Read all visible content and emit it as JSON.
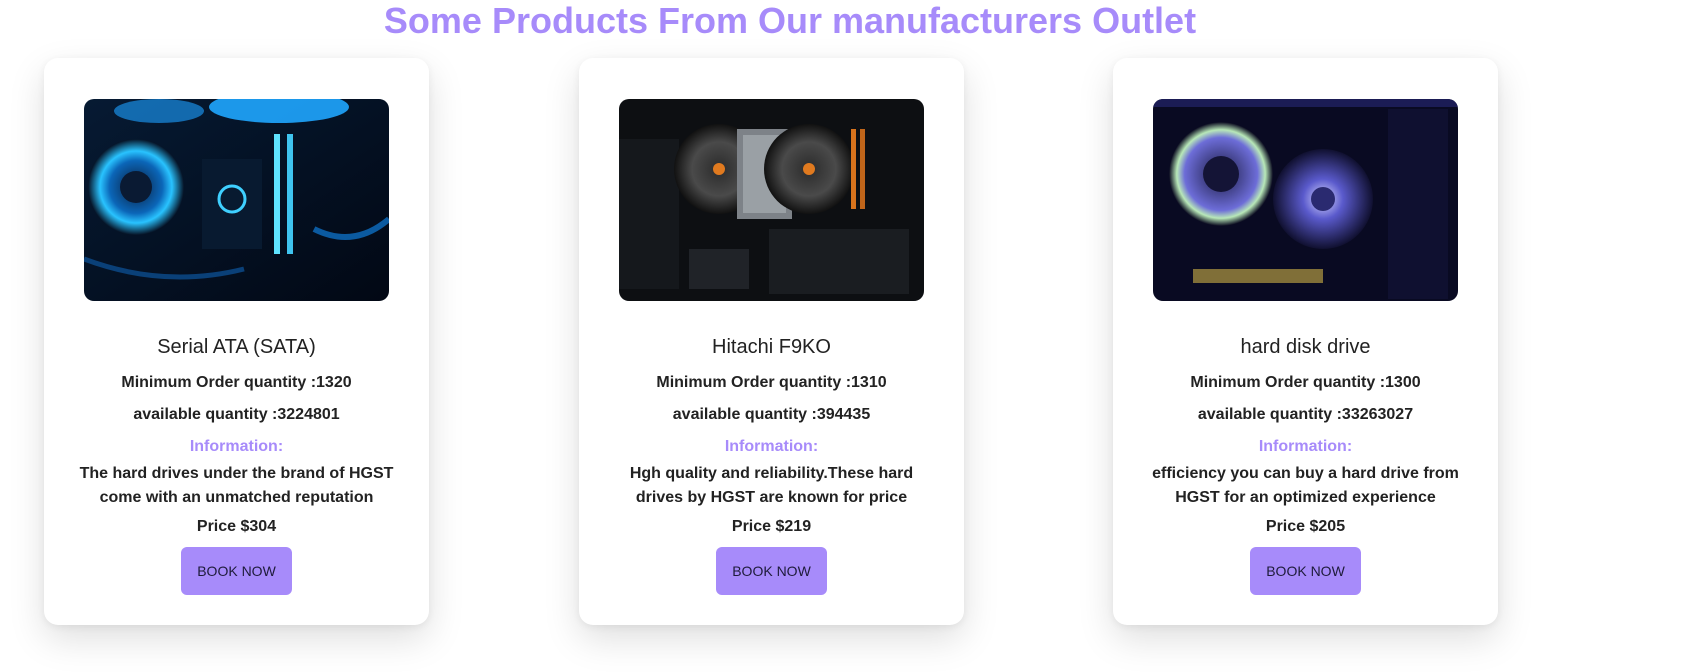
{
  "page": {
    "title": "Some Products From Our manufacturers Outlet"
  },
  "colors": {
    "accent": "#a78bfa",
    "text": "#222222",
    "card_bg": "#ffffff"
  },
  "products": [
    {
      "name": "Serial ATA (SATA)",
      "min_order_text": "Minimum Order quantity :1320",
      "available_text": "available quantity :3224801",
      "info_label": "Information:",
      "info_text": "The hard drives under the brand of HGST come with an unmatched reputation",
      "price_text": "Price $304",
      "button_label": "BOOK NOW",
      "image_icon": "pc-cooling-fan-image"
    },
    {
      "name": "Hitachi F9KO",
      "min_order_text": "Minimum Order quantity :1310",
      "available_text": "available quantity :394435",
      "info_label": "Information:",
      "info_text": "Hgh quality and reliability.These hard drives by HGST are known for price",
      "price_text": "Price $219",
      "button_label": "BOOK NOW",
      "image_icon": "pc-cpu-cooler-image"
    },
    {
      "name": "hard disk drive",
      "min_order_text": "Minimum Order quantity :1300",
      "available_text": "available quantity :33263027",
      "info_label": "Information:",
      "info_text": "efficiency you can buy a hard drive from HGST for an optimized experience",
      "price_text": "Price $205",
      "button_label": "BOOK NOW",
      "image_icon": "pc-rgb-fans-image"
    }
  ]
}
